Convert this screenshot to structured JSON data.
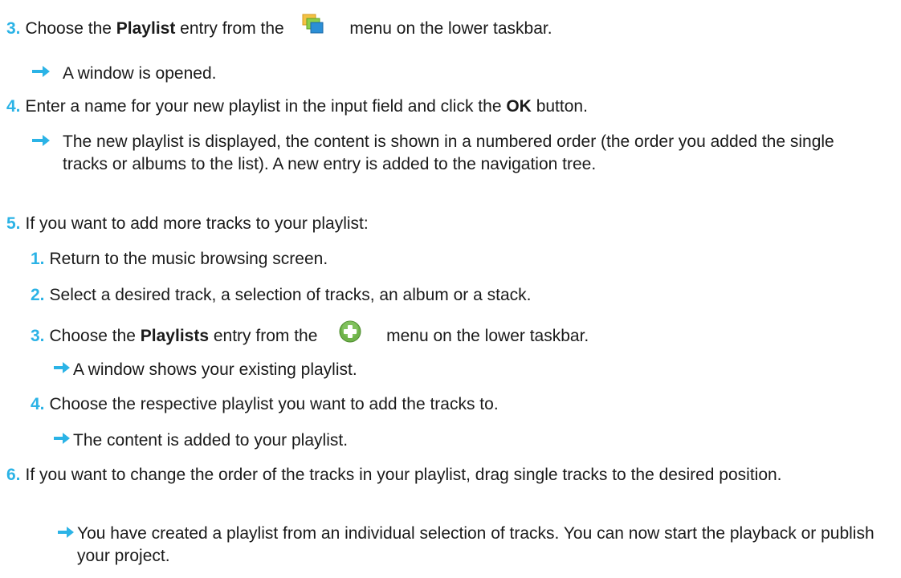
{
  "steps": {
    "s3": {
      "num": "3.",
      "pre": "Choose the",
      "bold": "Playlist",
      "mid": "entry from the",
      "post": "menu on the lower taskbar.",
      "icon": "windows-stack-icon"
    },
    "r3": "A window is opened.",
    "s4": {
      "num": "4.",
      "pre": "Enter a name for your new playlist in the input field and click the",
      "bold": "OK",
      "post": "button."
    },
    "r4": "The new playlist is displayed, the content is shown in a numbered order (the order you added the single tracks or albums to the list). A new entry is added to the navigation tree.",
    "s5": {
      "num": "5.",
      "text": "If you want to add more tracks to your playlist:"
    },
    "sub": {
      "s1": {
        "num": "1.",
        "text": "Return to the music browsing screen."
      },
      "s2": {
        "num": "2.",
        "text": "Select a desired track, a selection of tracks, an album or a stack."
      },
      "s3": {
        "num": "3.",
        "pre": "Choose the",
        "bold": "Playlists",
        "mid": "entry from the",
        "post": "menu on the lower taskbar.",
        "icon": "green-plus-icon"
      },
      "r3": "A window shows your existing playlist.",
      "s4": {
        "num": "4.",
        "text": "Choose the respective playlist you want to add the tracks to."
      },
      "r4": "The content is added to your playlist."
    },
    "s6": {
      "num": "6.",
      "text": "If you want to change the order of the tracks in your playlist, drag single tracks to the desired position."
    },
    "r6": "You have created a playlist from an individual selection of tracks. You can now start the playback or publish your project."
  },
  "colors": {
    "step_number": "#2bb3e6",
    "arrow": "#2bb3e6",
    "text": "#1a1a1a"
  }
}
